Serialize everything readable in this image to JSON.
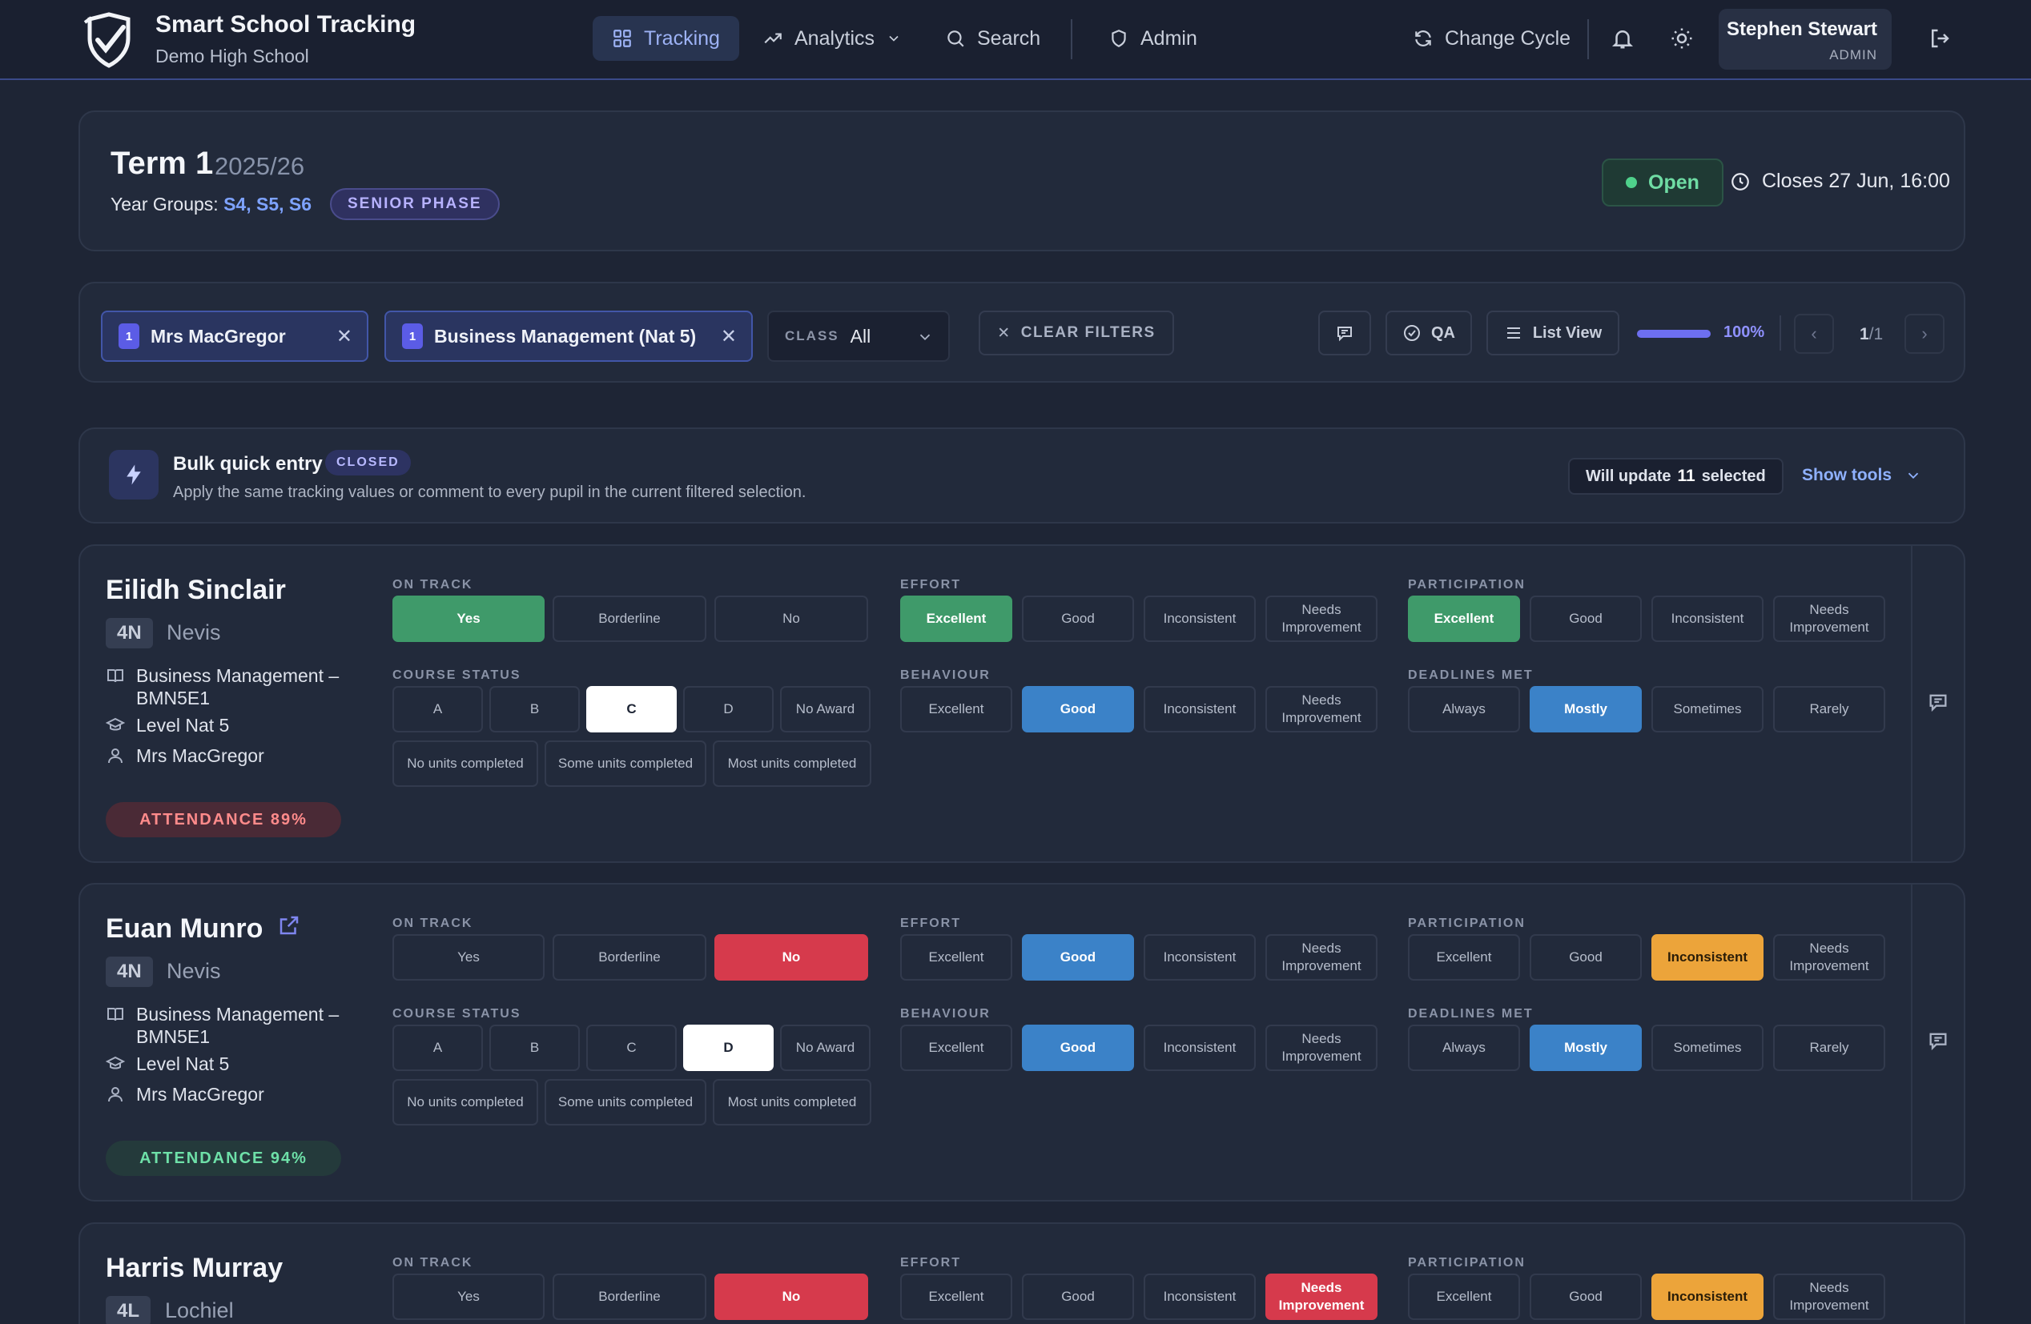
{
  "header": {
    "app_title": "Smart School Tracking",
    "school_name": "Demo High School",
    "nav": {
      "tracking": "Tracking",
      "analytics": "Analytics",
      "search": "Search",
      "admin": "Admin"
    },
    "change_cycle": "Change Cycle",
    "user": {
      "name": "Stephen Stewart",
      "role": "ADMIN"
    }
  },
  "term": {
    "title": "Term 1",
    "year": "2025/26",
    "year_groups_label": "Year Groups: ",
    "year_groups_value": "S4, S5, S6",
    "phase": "SENIOR PHASE",
    "status": "Open",
    "closes": "Closes 27 Jun, 16:00"
  },
  "filters": {
    "teacher_chip": {
      "count": "1",
      "label": "Mrs MacGregor"
    },
    "subject_chip": {
      "count": "1",
      "label": "Business Management (Nat 5)"
    },
    "class_label": "CLASS",
    "class_value": "All",
    "clear_label": "CLEAR FILTERS",
    "qa_label": "QA",
    "list_view_label": "List View",
    "progress_fraction": 1.0,
    "progress_text": "100%",
    "page_current": "1",
    "page_total": "/1"
  },
  "bulk": {
    "title": "Bulk quick entry",
    "badge": "CLOSED",
    "description": "Apply the same tracking values or comment to every pupil in the current filtered selection.",
    "will_update_prefix": "Will update",
    "will_update_count": "11",
    "will_update_suffix": "selected",
    "show_tools": "Show tools"
  },
  "labels": {
    "on_track": "ON TRACK",
    "course_status": "COURSE STATUS",
    "effort": "EFFORT",
    "behaviour": "BEHAVIOUR",
    "participation": "PARTICIPATION",
    "deadlines_met": "DEADLINES MET"
  },
  "options": {
    "on_track": [
      "Yes",
      "Borderline",
      "No"
    ],
    "course_status": [
      "A",
      "B",
      "C",
      "D",
      "No Award"
    ],
    "units": [
      "No units completed",
      "Some units completed",
      "Most units completed"
    ],
    "effort": [
      "Excellent",
      "Good",
      "Inconsistent",
      "Needs Improvement"
    ],
    "behaviour": [
      "Excellent",
      "Good",
      "Inconsistent",
      "Needs Improvement"
    ],
    "participation": [
      "Excellent",
      "Good",
      "Inconsistent",
      "Needs Improvement"
    ],
    "deadlines": [
      "Always",
      "Mostly",
      "Sometimes",
      "Rarely"
    ]
  },
  "colors": {
    "green": "#3f9a6a",
    "blue": "#3b82c8",
    "red": "#d63a4c",
    "amber": "#eca43a",
    "white": "#ffffff",
    "accent": "#6d6ff0"
  },
  "students": [
    {
      "name": "Eilidh Sinclair",
      "reg": "4N",
      "house": "Nevis",
      "subject": "Business Management – BMN5E1",
      "level": "Level Nat 5",
      "teacher": "Mrs MacGregor",
      "attendance": "ATTENDANCE 89%",
      "has_link": false,
      "on_track": "Yes",
      "course_status": "C",
      "effort": "Excellent",
      "behaviour": "Good",
      "participation": "Excellent",
      "deadlines": "Mostly"
    },
    {
      "name": "Euan Munro",
      "reg": "4N",
      "house": "Nevis",
      "subject": "Business Management – BMN5E1",
      "level": "Level Nat 5",
      "teacher": "Mrs MacGregor",
      "attendance": "ATTENDANCE 94%",
      "has_link": true,
      "on_track": "No",
      "course_status": "D",
      "effort": "Good",
      "behaviour": "Good",
      "participation": "Inconsistent",
      "deadlines": "Mostly"
    },
    {
      "name": "Harris Murray",
      "reg": "4L",
      "house": "Lochiel",
      "on_track": "No",
      "effort": "Needs Improvement",
      "participation": "Inconsistent"
    }
  ]
}
